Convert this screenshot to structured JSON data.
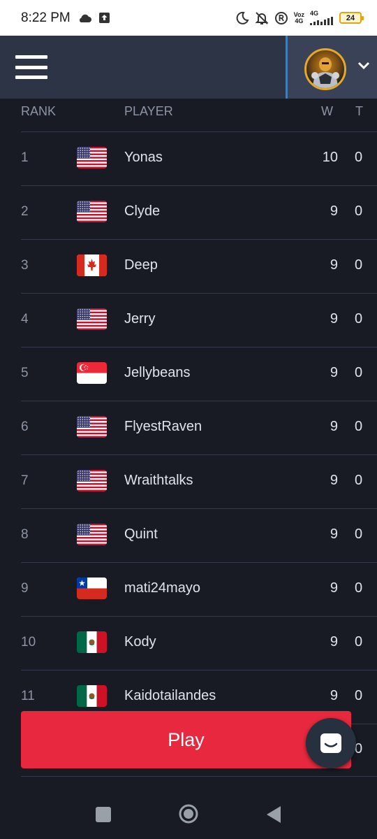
{
  "status_bar": {
    "time": "8:22 PM",
    "icons": [
      "cloud-icon",
      "upload-icon",
      "moon-icon",
      "bell-off-icon",
      "registered-icon",
      "volte-icon",
      "signal-icon",
      "battery-icon"
    ],
    "volte_label_top": "Voz",
    "volte_label_bottom": "4G",
    "net_label": "4G",
    "battery_level": "24",
    "battery_color": "#e0a60a"
  },
  "header": {
    "menu_icon": "hamburger-icon",
    "avatar_icon": "avatar-image",
    "dropdown_icon": "chevron-down-icon",
    "accent_color": "#1e88e5"
  },
  "table": {
    "columns": {
      "rank": "RANK",
      "player": "PLAYER",
      "w": "W",
      "t": "T"
    },
    "rows": [
      {
        "rank": "1",
        "flag": "us",
        "player": "Yonas",
        "w": "10",
        "t": "0"
      },
      {
        "rank": "2",
        "flag": "us",
        "player": "Clyde",
        "w": "9",
        "t": "0"
      },
      {
        "rank": "3",
        "flag": "ca",
        "player": "Deep",
        "w": "9",
        "t": "0"
      },
      {
        "rank": "4",
        "flag": "us",
        "player": "Jerry",
        "w": "9",
        "t": "0"
      },
      {
        "rank": "5",
        "flag": "sg",
        "player": "Jellybeans",
        "w": "9",
        "t": "0"
      },
      {
        "rank": "6",
        "flag": "us",
        "player": "FlyestRaven",
        "w": "9",
        "t": "0"
      },
      {
        "rank": "7",
        "flag": "us",
        "player": "Wraithtalks",
        "w": "9",
        "t": "0"
      },
      {
        "rank": "8",
        "flag": "us",
        "player": "Quint",
        "w": "9",
        "t": "0"
      },
      {
        "rank": "9",
        "flag": "cl",
        "player": "mati24mayo",
        "w": "9",
        "t": "0"
      },
      {
        "rank": "10",
        "flag": "mx",
        "player": "Kody",
        "w": "9",
        "t": "0"
      },
      {
        "rank": "11",
        "flag": "mx",
        "player": "Kaidotailandes",
        "w": "9",
        "t": "0"
      }
    ],
    "partial_row_t": "0"
  },
  "play_button": {
    "label": "Play",
    "color": "#e8283e"
  },
  "chat_button": {
    "icon": "chat-icon"
  },
  "nav_bar": {
    "icons": [
      "recents-icon",
      "home-icon",
      "back-icon"
    ]
  }
}
